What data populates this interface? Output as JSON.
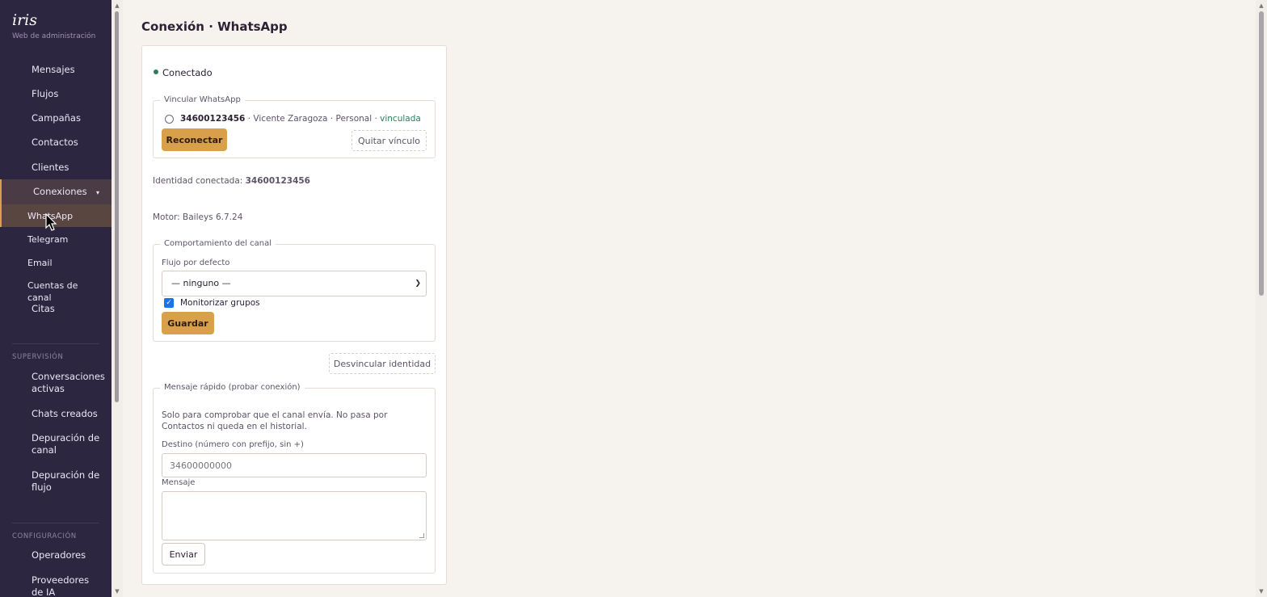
{
  "brand": {
    "name": "iris",
    "subtitle": "Web de administración"
  },
  "sidebar": {
    "items": [
      {
        "label": "Mensajes"
      },
      {
        "label": "Flujos"
      },
      {
        "label": "Campañas"
      },
      {
        "label": "Contactos"
      },
      {
        "label": "Clientes"
      },
      {
        "label": "Conexiones",
        "expanded": true
      }
    ],
    "sub_items": [
      {
        "label": "WhatsApp",
        "active": true
      },
      {
        "label": "Telegram"
      },
      {
        "label": "Email"
      },
      {
        "label": "Cuentas de canal"
      },
      {
        "label": "Citas"
      }
    ],
    "supervision": {
      "label": "SUPERVISIÓN",
      "items": [
        {
          "label": "Conversaciones activas"
        },
        {
          "label": "Chats creados"
        },
        {
          "label": "Depuración de canal"
        },
        {
          "label": "Depuración de flujo"
        }
      ]
    },
    "config": {
      "label": "CONFIGURACIÓN",
      "items": [
        {
          "label": "Operadores"
        },
        {
          "label": "Proveedores de IA"
        }
      ]
    }
  },
  "page": {
    "title": "Conexión · WhatsApp"
  },
  "status": {
    "label": "Conectado",
    "color": "#2e7d5b"
  },
  "link": {
    "legend": "Vincular WhatsApp",
    "number": "34600123456",
    "details": " · Vicente Zaragoza · Personal · ",
    "state": "vinculada",
    "reconnect_label": "Reconectar",
    "unlink_label": "Quitar vínculo"
  },
  "identity": {
    "prefix": "Identidad conectada: ",
    "value": "34600123456"
  },
  "engine": {
    "text": "Motor: Baileys 6.7.24"
  },
  "behavior": {
    "legend": "Comportamiento del canal",
    "flow_label": "Flujo por defecto",
    "flow_value": "— ninguno —",
    "monitor_label": "Monitorizar grupos",
    "monitor_checked": true,
    "save_label": "Guardar"
  },
  "unlink_identity_label": "Desvincular identidad",
  "quick": {
    "legend": "Mensaje rápido (probar conexión)",
    "description": "Solo para comprobar que el canal envía. No pasa por Contactos ni queda en el historial.",
    "dest_label": "Destino (número con prefijo, sin +)",
    "dest_placeholder": "34600000000",
    "message_label": "Mensaje",
    "send_label": "Enviar"
  },
  "colors": {
    "accent": "#d8a04a",
    "sidebar_bg": "#2d2640",
    "page_bg": "#f6f2ee"
  }
}
